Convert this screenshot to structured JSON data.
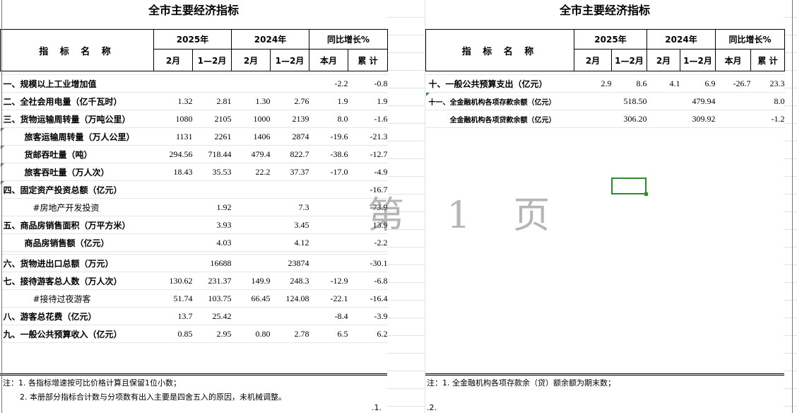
{
  "watermark": "第 1 页",
  "left": {
    "title": "全市主要经济指标",
    "header": {
      "name": "指 标 名 称",
      "groups": [
        "2025年",
        "2024年",
        "同比增长%"
      ],
      "sub": [
        "2月",
        "1—2月",
        "2月",
        "1—2月",
        "本月",
        "累 计"
      ]
    },
    "rows": [
      {
        "name": "一、规模以上工业增加值",
        "c": [
          "",
          "",
          "",
          "",
          "-2.2",
          "-0.8"
        ]
      },
      {
        "name": "二、全社会用电量（亿千瓦时）",
        "c": [
          "1.32",
          "2.81",
          "1.30",
          "2.76",
          "1.9",
          "1.9"
        ]
      },
      {
        "name": "三、货物运输周转量（万吨公里）",
        "c": [
          "1080",
          "2105",
          "1000",
          "2139",
          "8.0",
          "-1.6"
        ]
      },
      {
        "name": "旅客运输周转量（万人公里）",
        "c": [
          "1131",
          "2261",
          "1406",
          "2874",
          "-19.6",
          "-21.3"
        ]
      },
      {
        "name": "货邮吞吐量（吨）",
        "c": [
          "294.56",
          "718.44",
          "479.4",
          "822.7",
          "-38.6",
          "-12.7"
        ]
      },
      {
        "name": "旅客吞吐量（万人次）",
        "c": [
          "18.43",
          "35.53",
          "22.2",
          "37.37",
          "-17.0",
          "-4.9"
        ]
      },
      {
        "name": "四、固定资产投资总额（亿元）",
        "c": [
          "",
          "",
          "",
          "",
          "",
          "-16.7"
        ]
      },
      {
        "name": "#房地产开发投资",
        "c": [
          "",
          "1.92",
          "",
          "7.3",
          "",
          "-73.9"
        ]
      },
      {
        "name": "五、商品房销售面积（万平方米）",
        "c": [
          "",
          "3.93",
          "",
          "3.45",
          "",
          "13.9"
        ]
      },
      {
        "name": "商品房销售额（亿元）",
        "c": [
          "",
          "4.03",
          "",
          "4.12",
          "",
          "-2.2"
        ]
      },
      {
        "name": "六、货物进出口总额（万元）",
        "c": [
          "",
          "16688",
          "",
          "23874",
          "",
          "-30.1"
        ]
      },
      {
        "name": "七、接待游客总人数（万人次）",
        "c": [
          "130.62",
          "231.37",
          "149.9",
          "248.3",
          "-12.9",
          "-6.8"
        ]
      },
      {
        "name": "#接待过夜游客",
        "c": [
          "51.74",
          "103.75",
          "66.45",
          "124.08",
          "-22.1",
          "-16.4"
        ]
      },
      {
        "name": "八、游客总花费（亿元）",
        "c": [
          "13.7",
          "25.42",
          "",
          "",
          "-8.4",
          "-3.9"
        ]
      },
      {
        "name": "九、一般公共预算收入（亿元）",
        "c": [
          "0.85",
          "2.95",
          "0.80",
          "2.78",
          "6.5",
          "6.2"
        ]
      }
    ],
    "notes": [
      "注：1. 各指标增速按可比价格计算且保留1位小数；",
      "2. 本册部分指标合计数与分项数有出入主要是四舍五入的原因，未机械调整。"
    ],
    "page": ".1."
  },
  "right": {
    "title": "全市主要经济指标",
    "header": {
      "name": "指 标 名 称",
      "groups": [
        "2025年",
        "2024年",
        "同比增长%"
      ],
      "sub": [
        "2月",
        "1—2月",
        "2月",
        "1—2月",
        "本月",
        "累 计"
      ]
    },
    "rows": [
      {
        "name": "十、一般公共预算支出（亿元）",
        "c": [
          "2.9",
          "8.6",
          "4.1",
          "6.9",
          "-26.7",
          "23.3"
        ]
      },
      {
        "name": "十一、全金融机构各项存款余额（亿元）",
        "c": [
          "",
          "518.50",
          "",
          "479.94",
          "",
          "8.0"
        ]
      },
      {
        "name": "全金融机构各项贷款余额（亿元）",
        "c": [
          "",
          "306.20",
          "",
          "309.92",
          "",
          "-1.2"
        ]
      }
    ],
    "notes": [
      "注：1. 全金融机构各项存款余（贷）额余额为期末数；"
    ],
    "page": ".2."
  }
}
